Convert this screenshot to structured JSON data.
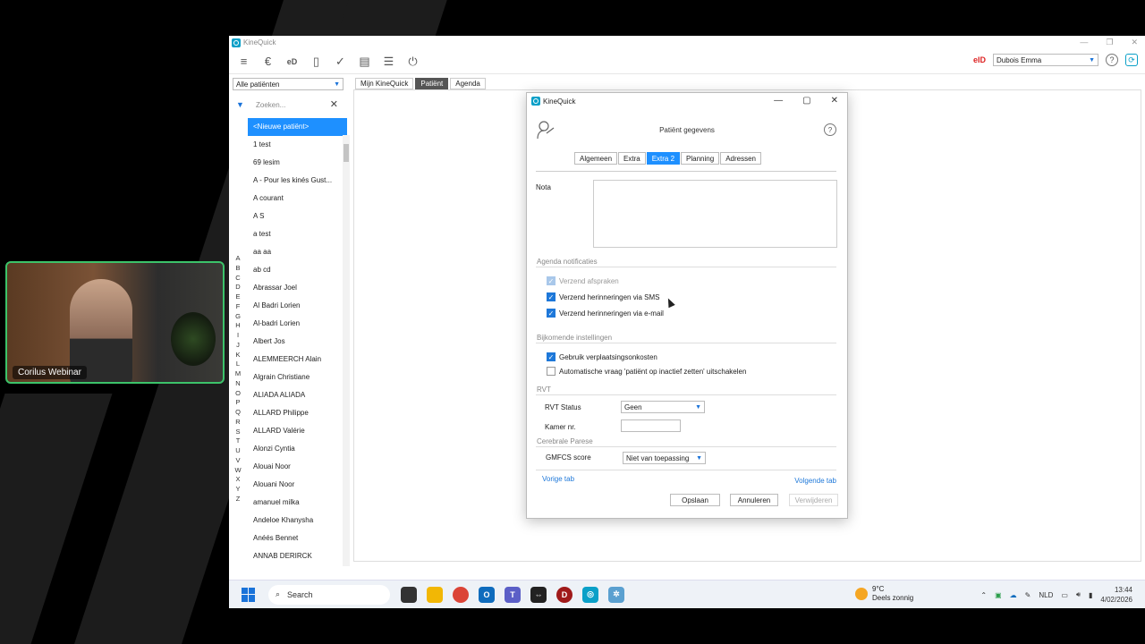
{
  "webcam": {
    "label": "Corilus Webinar"
  },
  "app": {
    "title": "KineQuick",
    "eid_badge": "eID",
    "user": "Dubois Emma",
    "toolbar_icons": [
      "menu-icon",
      "euro-icon",
      "eid-icon",
      "document-icon",
      "check-icon",
      "clipboard-icon",
      "list-icon",
      "power-icon"
    ]
  },
  "left_panel": {
    "filter": "Alle patiënten",
    "search_placeholder": "Zoeken...",
    "alphabet": [
      "A",
      "B",
      "C",
      "D",
      "E",
      "F",
      "G",
      "H",
      "I",
      "J",
      "K",
      "L",
      "M",
      "N",
      "O",
      "P",
      "Q",
      "R",
      "S",
      "T",
      "U",
      "V",
      "W",
      "X",
      "Y",
      "Z"
    ],
    "patients": [
      "<Nieuwe patiënt>",
      "1 test",
      "69 lesim",
      "A - Pour les kinés Gust...",
      "A courant",
      "A S",
      "a test",
      "aa aa",
      "ab cd",
      "Abrassar Joel",
      "Al Badri Lorien",
      "Al-badri  Lorien",
      "Albert Jos",
      "ALEMMEERCH Alain",
      "Algrain Christiane",
      "ALIADA ALIADA",
      "ALLARD Philippe",
      "ALLARD Valérie",
      "Alonzi Cyntia",
      "Alouai Noor",
      "Alouani Noor",
      "amanuel milka",
      "Andeloe Khanysha",
      "Anéés Bennet",
      "ANNAB DERIRCK"
    ]
  },
  "main_tabs": [
    "Mijn KineQuick",
    "Patiënt",
    "Agenda"
  ],
  "dialog": {
    "title": "KineQuick",
    "heading": "Patiënt gegevens",
    "tabs": [
      "Algemeen",
      "Extra",
      "Extra 2",
      "Planning",
      "Adressen"
    ],
    "active_tab": "Extra 2",
    "nota_label": "Nota",
    "sections": {
      "agenda": "Agenda notificaties",
      "bijkomende": "Bijkomende instellingen",
      "rvt": "RVT",
      "cerebrale": "Cerebrale Parese"
    },
    "checkboxes": {
      "verzend_afspraken": "Verzend afspraken",
      "herinneringen_sms": "Verzend herinneringen via SMS",
      "herinneringen_email": "Verzend herinneringen via e-mail",
      "verplaatsingsonkosten": "Gebruik verplaatsingsonkosten",
      "automatische_vraag": "Automatische vraag 'patiënt op inactief zetten' uitschakelen"
    },
    "rvt_status_label": "RVT Status",
    "rvt_status_value": "Geen",
    "kamer_label": "Kamer nr.",
    "gmfcs_label": "GMFCS score",
    "gmfcs_value": "Niet van toepassing",
    "prev_tab": "Vorige tab",
    "next_tab": "Volgende tab",
    "buttons": {
      "save": "Opslaan",
      "cancel": "Annuleren",
      "delete": "Verwijderen"
    }
  },
  "taskbar": {
    "search": "Search",
    "weather_temp": "9°C",
    "weather_desc": "Deels zonnig",
    "language": "NLD",
    "time": "13:44",
    "date": "4/02/2026"
  }
}
